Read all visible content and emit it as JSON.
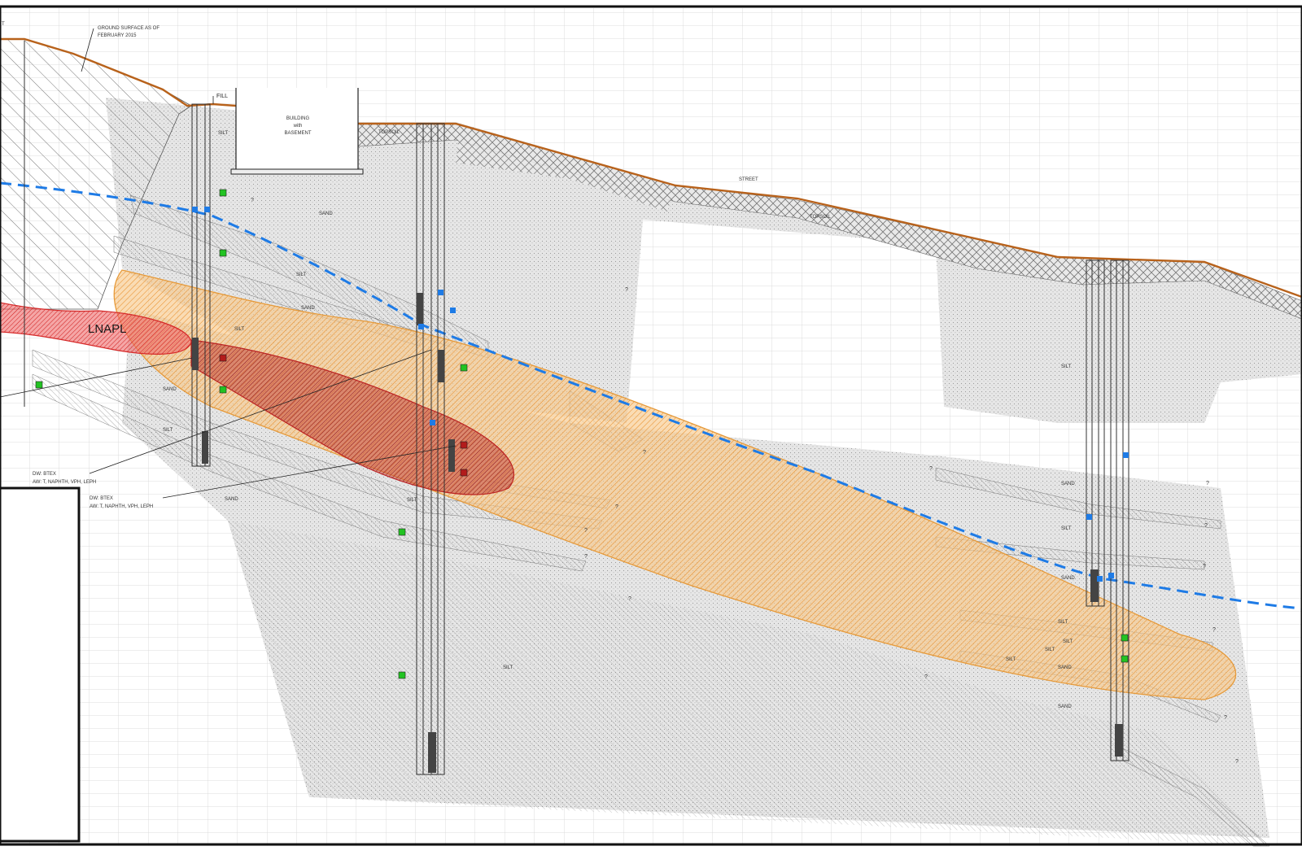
{
  "annotations": {
    "ground_surface": "GROUND SURFACE AS OF FEBRUARY 2015",
    "ground_surface_line1": "GROUND SURFACE AS OF",
    "ground_surface_line2": "FEBRUARY 2015",
    "fill": "FILL",
    "building_line1": "BUILDING",
    "building_line2": "with",
    "building_line3": "BASEMENT",
    "street": "STREET",
    "topsoil_1": "TOPSOIL",
    "topsoil_2": "TOPSOIL",
    "lnapl": "LNAPL",
    "edge_glyph": "n",
    "top_edge_glyph": "T"
  },
  "soil_labels": {
    "sand_1": "SAND",
    "sand_2": "SAND",
    "sand_3": "SAND",
    "sand_4": "SAND",
    "sand_5": "SAND",
    "sand_6": "SAND",
    "sand_7": "SAND",
    "sand_8": "SAND",
    "silt_1": "SILT",
    "silt_2": "SILT",
    "silt_3": "SILT",
    "silt_4": "SILT",
    "silt_5": "SILT",
    "silt_6": "SILT",
    "silt_7": "SILT",
    "silt_8": "SILT",
    "silt_9": "SILT",
    "silt_10": "SILT",
    "silt_11": "SILT",
    "silt_12": "SILT"
  },
  "callouts": {
    "well_a_line1": "DW: BTEX",
    "well_a_line2": "AW: T, NAPHTH, VPH, LEPH",
    "well_b_line1": "DW: BTEX",
    "well_b_line2": "AW: T, NAPHTH, VPH, LEPH"
  },
  "uncertain_marker": "?",
  "colors": {
    "ground_surface": "#b8621b",
    "water_table": "#1e7be6",
    "dissolved_plume": "#f0a040",
    "lnapl_plume": "#d62a2a",
    "soil_fill": "#e3e3e3",
    "sample_ok": "#22c322",
    "sample_impacted": "#b31b1b",
    "grid": "#cfcfcf"
  },
  "legend": {
    "ground_surface": "line",
    "water_table": "dashed-line",
    "dissolved_plume": "orange-hatch",
    "lnapl": "red-hatch"
  }
}
